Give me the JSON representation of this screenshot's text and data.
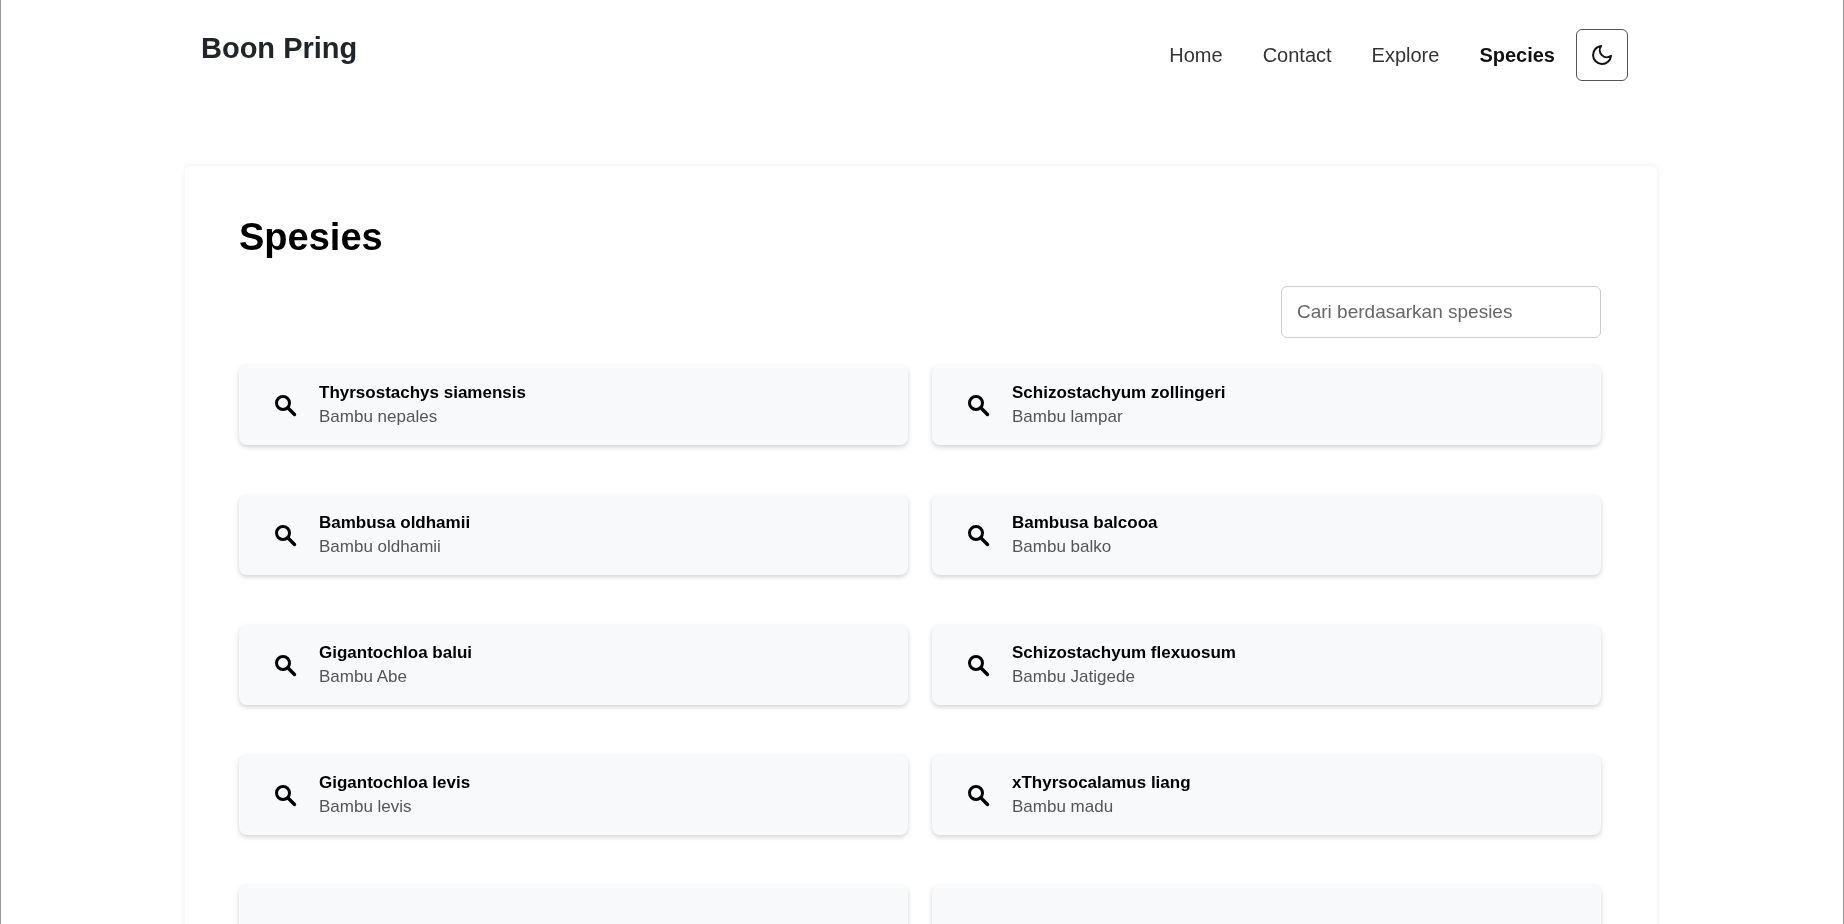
{
  "brand": "Boon Pring",
  "nav": [
    {
      "label": "Home",
      "selected": false
    },
    {
      "label": "Contact",
      "selected": false
    },
    {
      "label": "Explore",
      "selected": false
    },
    {
      "label": "Species",
      "selected": true
    }
  ],
  "page_title": "Spesies",
  "search": {
    "placeholder": "Cari berdasarkan spesies"
  },
  "species": [
    {
      "name": "Thyrsostachys siamensis",
      "local_name": "Bambu nepales"
    },
    {
      "name": "Schizostachyum zollingeri",
      "local_name": "Bambu lampar"
    },
    {
      "name": "Bambusa oldhamii",
      "local_name": "Bambu oldhamii"
    },
    {
      "name": "Bambusa balcooa",
      "local_name": "Bambu balko"
    },
    {
      "name": "Gigantochloa balui",
      "local_name": "Bambu Abe"
    },
    {
      "name": "Schizostachyum flexuosum",
      "local_name": "Bambu Jatigede"
    },
    {
      "name": "Gigantochloa levis",
      "local_name": "Bambu levis"
    },
    {
      "name": "xThyrsocalamus liang",
      "local_name": "Bambu madu"
    }
  ]
}
